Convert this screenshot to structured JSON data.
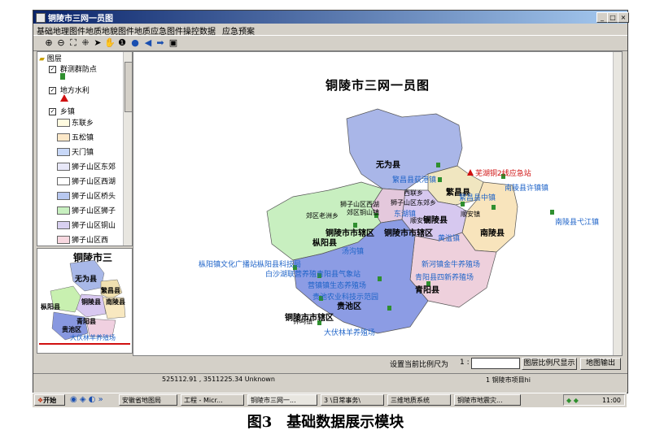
{
  "window": {
    "title": "铜陵市三网一员图"
  },
  "menu": [
    "基础地理图件",
    "地质地貌图件",
    "地质应急图件",
    "操控数据",
    "应急预案"
  ],
  "toolbar_icons": [
    "zoom-in-icon",
    "zoom-out-icon",
    "full-extent-icon",
    "fixed-zoom-icon",
    "select-arrow-icon",
    "pan-hand-icon",
    "info-icon",
    "globe-icon",
    "back-arrow-icon",
    "forward-arrow-icon",
    "layout-icon"
  ],
  "layers": {
    "root": "图层",
    "items": [
      {
        "label": "群测群防点"
      },
      {
        "label": "地方水利"
      },
      {
        "label": "乡镇"
      }
    ],
    "townships": [
      "东联乡",
      "五松镇",
      "天门镇",
      "狮子山区东郊",
      "狮子山区西湖",
      "狮子山区桥头",
      "狮子山区狮子",
      "狮子山区铜山",
      "狮子山区西"
    ]
  },
  "overview": {
    "title": "铜陵市三",
    "labels": [
      "无为县",
      "繁昌县",
      "铜陵县",
      "枞阳县",
      "南陵县",
      "青阳县",
      "贵池区",
      "大伏林羊养殖场"
    ]
  },
  "map": {
    "title": "铜陵市三网一员图",
    "labels_bold": [
      {
        "text": "无为县"
      },
      {
        "text": "繁昌县"
      },
      {
        "text": "铜陵县"
      },
      {
        "text": "南陵县"
      },
      {
        "text": "铜陵市市辖区"
      },
      {
        "text": "铜陵市市辖区"
      },
      {
        "text": "枞阳县"
      },
      {
        "text": "青阳县"
      },
      {
        "text": "贵池区"
      },
      {
        "text": "铜陵市市辖区"
      }
    ],
    "labels_blue": [
      {
        "text": "繁昌县荻港镇"
      },
      {
        "text": "南陵县许镇镇"
      },
      {
        "text": "繁昌县中镇"
      },
      {
        "text": "南陵县弋江镇"
      },
      {
        "text": "枞阳镇文化广播站枞阳县科技局"
      },
      {
        "text": "汤沟镇"
      },
      {
        "text": "白沙湖联营养殖青阳县气象站"
      },
      {
        "text": "青阳县四新养殖场"
      },
      {
        "text": "营镇镇生态养殖场"
      },
      {
        "text": "新河镇金牛养殖场"
      },
      {
        "text": "贵池农业科技示范园"
      },
      {
        "text": "大伏林羊养殖场"
      },
      {
        "text": "东湖镇"
      },
      {
        "text": "黄湓镇"
      }
    ],
    "labels_red": [
      {
        "text": "芜湖铜2线应急站"
      }
    ],
    "labels_small": [
      {
        "text": "西联乡"
      },
      {
        "text": "顺安镇"
      },
      {
        "text": "狮子山区东郊乡"
      },
      {
        "text": "顺安镇"
      },
      {
        "text": "郊区老洲乡"
      },
      {
        "text": "郊区铜山镇"
      },
      {
        "text": "狮子山区西湖"
      },
      {
        "text": "钟鸣镇"
      }
    ]
  },
  "scale": {
    "label": "设置当前比例尺为",
    "prefix": "1 :",
    "value": "",
    "show_button": "图层比例尺显示",
    "export_button": "地图输出"
  },
  "status": {
    "coords": "525112.91 , 3511225.34 Unknown",
    "layer": "1 铜陵市项目hi"
  },
  "taskbar": {
    "start": "开始",
    "items": [
      "安徽省地图局",
      "工程 - Micr...",
      "铜陵市三网一...",
      "3 \\日常事务\\",
      "三维地质系统",
      "铜陵市地震灾..."
    ],
    "tray": "11:00"
  },
  "caption": "图3　基础数据展示模块"
}
